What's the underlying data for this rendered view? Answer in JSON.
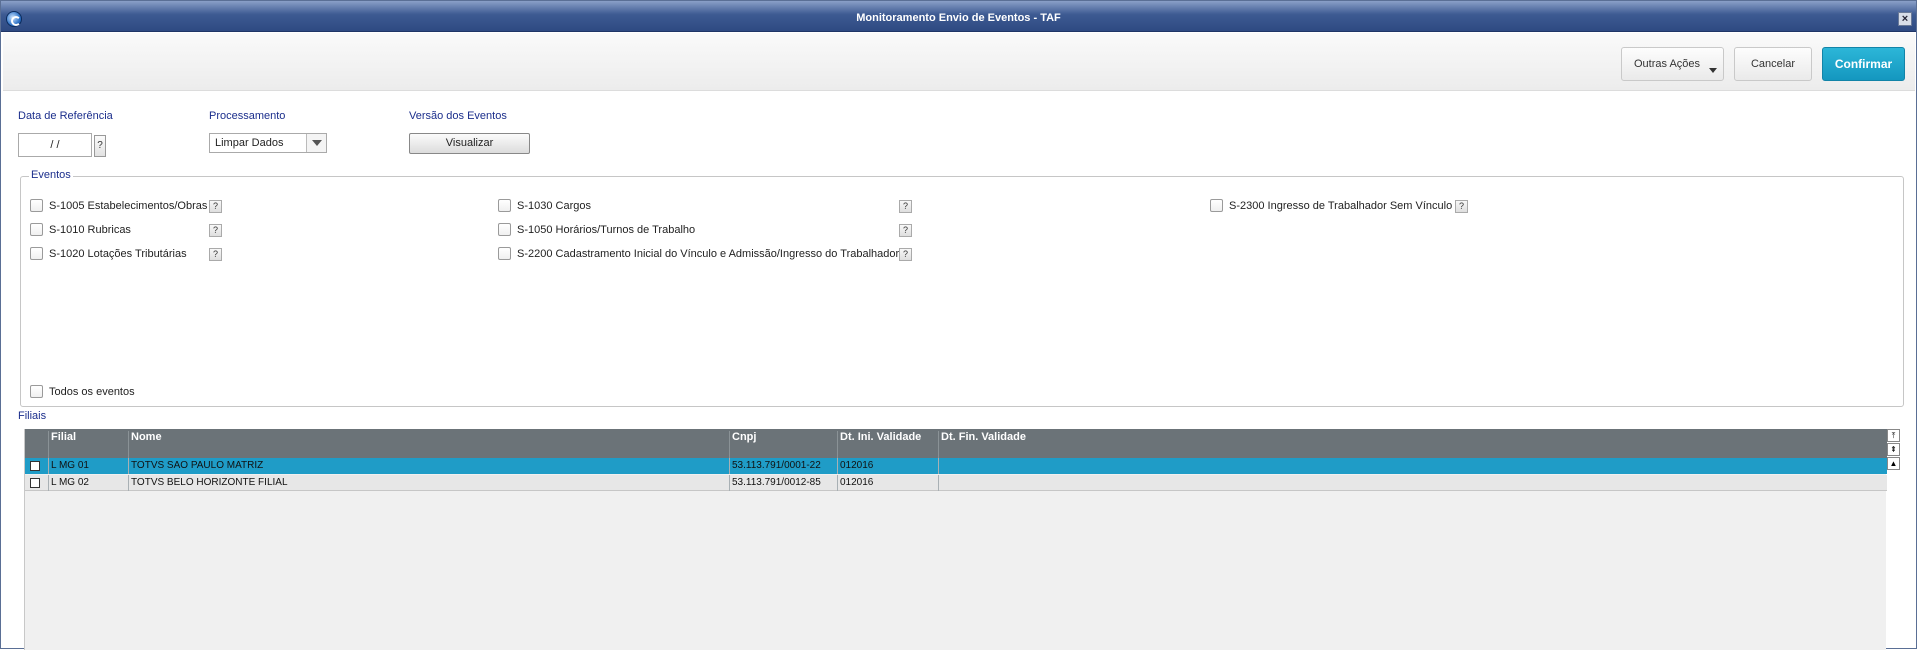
{
  "window": {
    "title": "Monitoramento Envio de Eventos - TAF"
  },
  "toolbar": {
    "outras_acoes": "Outras Ações",
    "cancelar": "Cancelar",
    "confirmar": "Confirmar"
  },
  "fields": {
    "data_referencia_label": "Data de Referência",
    "data_referencia_value": " / /",
    "processamento_label": "Processamento",
    "processamento_value": "Limpar Dados",
    "versao_label": "Versão dos Eventos",
    "visualizar": "Visualizar",
    "help": "?"
  },
  "eventos": {
    "legend": "Eventos",
    "items": [
      "S-1005 Estabelecimentos/Obras",
      "S-1010 Rubricas",
      "S-1020 Lotações Tributárias",
      "S-1030 Cargos",
      "S-1050 Horários/Turnos de Trabalho",
      "S-2200 Cadastramento Inicial do Vínculo e Admissão/Ingresso do Trabalhador",
      "S-2300 Ingresso de Trabalhador Sem Vínculo"
    ],
    "todos": "Todos os eventos"
  },
  "filiais": {
    "label": "Filiais",
    "columns": [
      "Filial",
      "Nome",
      "Cnpj",
      "Dt. Ini. Validade",
      "Dt. Fin. Validade"
    ],
    "rows": [
      {
        "filial": "L MG 01",
        "nome": "TOTVS SAO PAULO MATRIZ",
        "cnpj": "53.113.791/0001-22",
        "ini": "012016",
        "fin": ""
      },
      {
        "filial": "L MG 02",
        "nome": "TOTVS BELO HORIZONTE FILIAL",
        "cnpj": "53.113.791/0012-85",
        "ini": "012016",
        "fin": ""
      }
    ]
  },
  "colors": {
    "titlebar": "#2e4a82",
    "confirm": "#1497bf",
    "selected_row": "#1f9cc7",
    "label": "#1b2e8c"
  }
}
